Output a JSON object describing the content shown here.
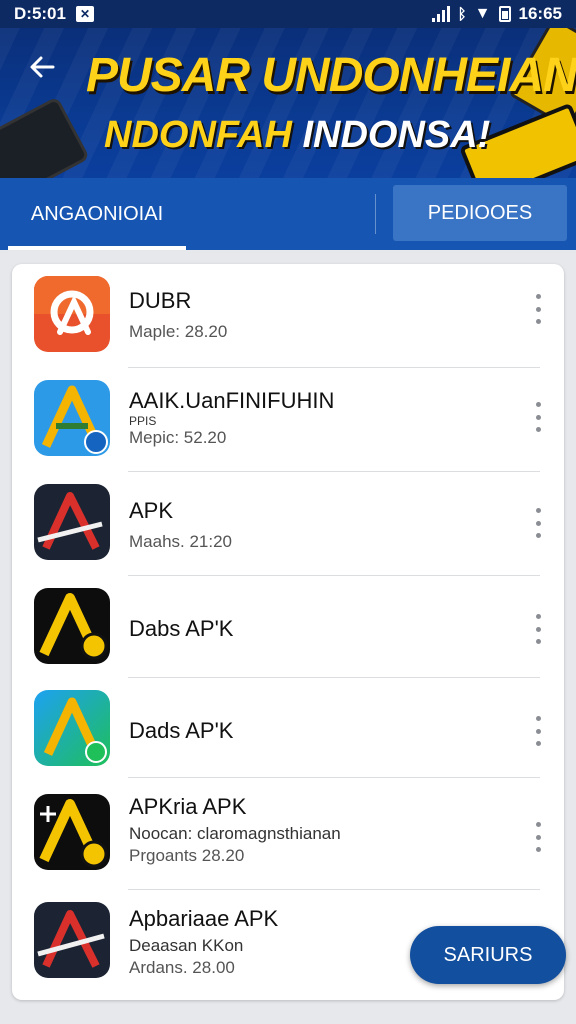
{
  "status_bar": {
    "time_left": "D:5:01",
    "time_right": "16:65",
    "icons": [
      "image-box-icon",
      "signal-icon",
      "bluetooth-icon",
      "wifi-icon",
      "battery-icon"
    ]
  },
  "header": {
    "back_icon": "arrow-left-icon",
    "title": "PUSAR UNDONHEIAN",
    "subtitle_yellow": "NDONFAH",
    "subtitle_white": "INDONSA!"
  },
  "tabs": [
    {
      "label": "ANGAONIOIAI",
      "selected": true
    },
    {
      "label": "PEDIOOES",
      "selected": false
    }
  ],
  "apps": [
    {
      "name": "DUBR",
      "extra": "",
      "meta": "Maple: 28.20",
      "icon": "orange-a-app-icon"
    },
    {
      "name": "AAIK.UanFINIFUHIN",
      "extra": "PPIS",
      "meta": "Mepic: 52.20",
      "icon": "blue-a-app-icon"
    },
    {
      "name": "APK",
      "extra": "",
      "meta": "Maahs. 21:20",
      "icon": "dark-red-a-app-icon"
    },
    {
      "name": "Dabs AP'K",
      "extra": "",
      "meta": "",
      "icon": "yellow-a-app-icon"
    },
    {
      "name": "Dads AP'K",
      "extra": "",
      "meta": "",
      "icon": "green-a-app-icon"
    },
    {
      "name": "APKria APK",
      "extra": "Noocan: claromagnsthianan",
      "meta": "Prgoants 28.20",
      "icon": "yellow-a-app-icon"
    },
    {
      "name": "Apbariaae APK",
      "extra": "Deaasan KKon",
      "meta": "Ardans. 28.00",
      "icon": "dark-red-a-app-icon"
    }
  ],
  "fab": {
    "label": "SARIURS"
  },
  "colors": {
    "header_blue": "#0a3a92",
    "tab_blue": "#1656b2",
    "banner_yellow": "#ffd21a",
    "fab_blue": "#124f9e"
  }
}
